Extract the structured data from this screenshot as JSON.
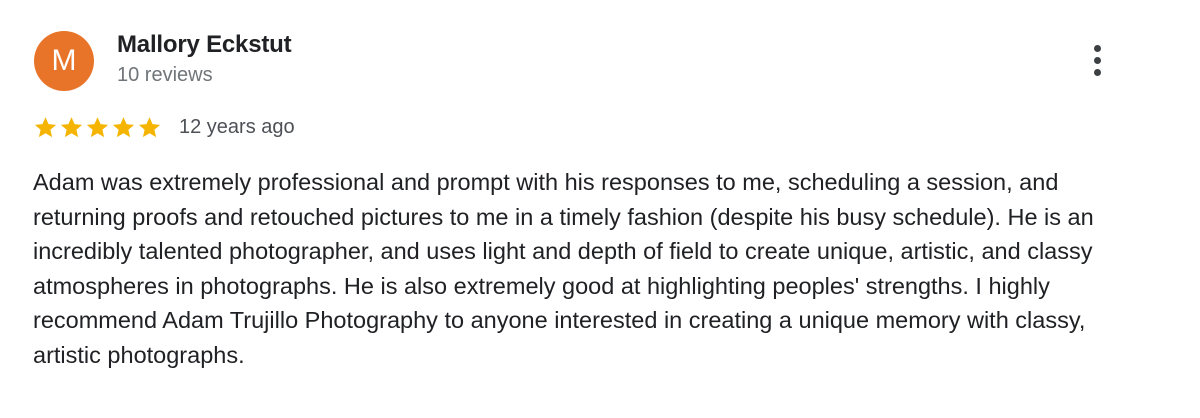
{
  "reviewer": {
    "initial": "M",
    "name": "Mallory Eckstut",
    "review_count": "10 reviews",
    "avatar_color": "#e8742a"
  },
  "review": {
    "rating": 5,
    "max_rating": 5,
    "star_color": "#f4b400",
    "date": "12 years ago",
    "text": "Adam was extremely professional and prompt with his responses to me, scheduling a session, and returning proofs and retouched pictures to me in a timely fashion (despite his busy schedule). He is an incredibly talented photographer, and uses light and depth of field to create unique, artistic, and classy atmospheres in photographs. He is also extremely good at highlighting peoples' strengths. I highly recommend Adam Trujillo Photography to anyone interested in creating a unique memory with classy, artistic photographs."
  },
  "menu": {
    "icon": "more-vert-icon"
  }
}
